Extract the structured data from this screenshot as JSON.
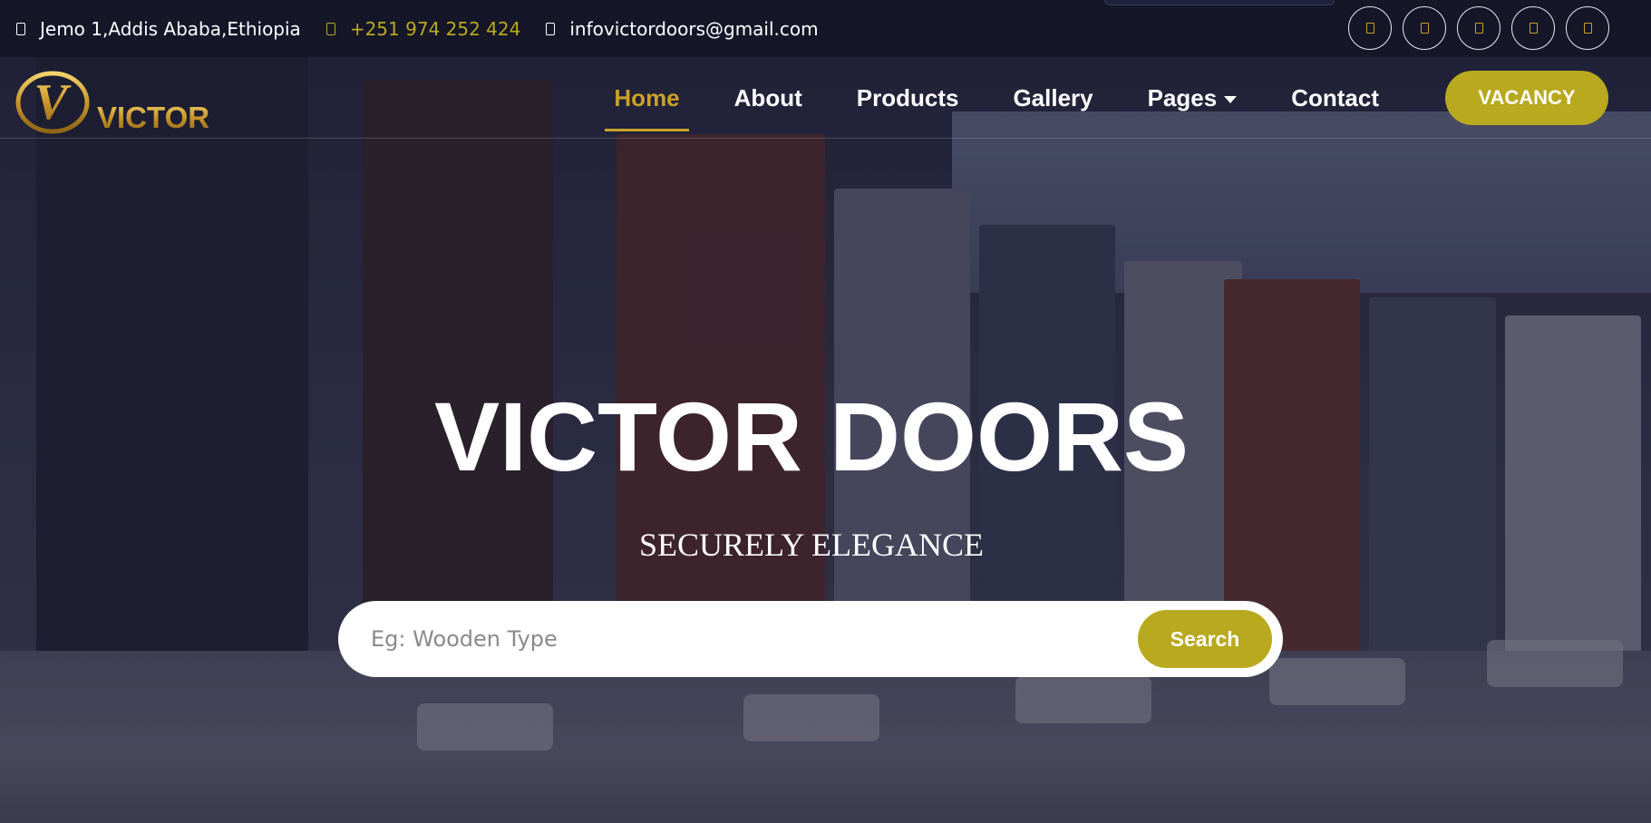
{
  "topbar": {
    "address": "Jemo 1,Addis Ababa,Ethiopia",
    "phone": "+251 974 252 424",
    "email": "infovictordoors@gmail.com",
    "socials": [
      "facebook-icon",
      "twitter-icon",
      "instagram-icon",
      "linkedin-icon",
      "youtube-icon"
    ]
  },
  "brand": {
    "name": "VICTOR",
    "initial": "V"
  },
  "nav": {
    "items": [
      {
        "label": "Home",
        "active": true
      },
      {
        "label": "About"
      },
      {
        "label": "Products"
      },
      {
        "label": "Gallery"
      },
      {
        "label": "Pages",
        "dropdown": true
      },
      {
        "label": "Contact"
      }
    ],
    "cta": "VACANCY"
  },
  "hero": {
    "title": "VICTOR DOORS",
    "subtitle": "SECURELY ELEGANCE",
    "search_placeholder": "Eg: Wooden Type",
    "search_button": "Search"
  },
  "colors": {
    "accent": "#b8a91f",
    "gold": "#c9a227",
    "topbar_bg": "#151628"
  }
}
